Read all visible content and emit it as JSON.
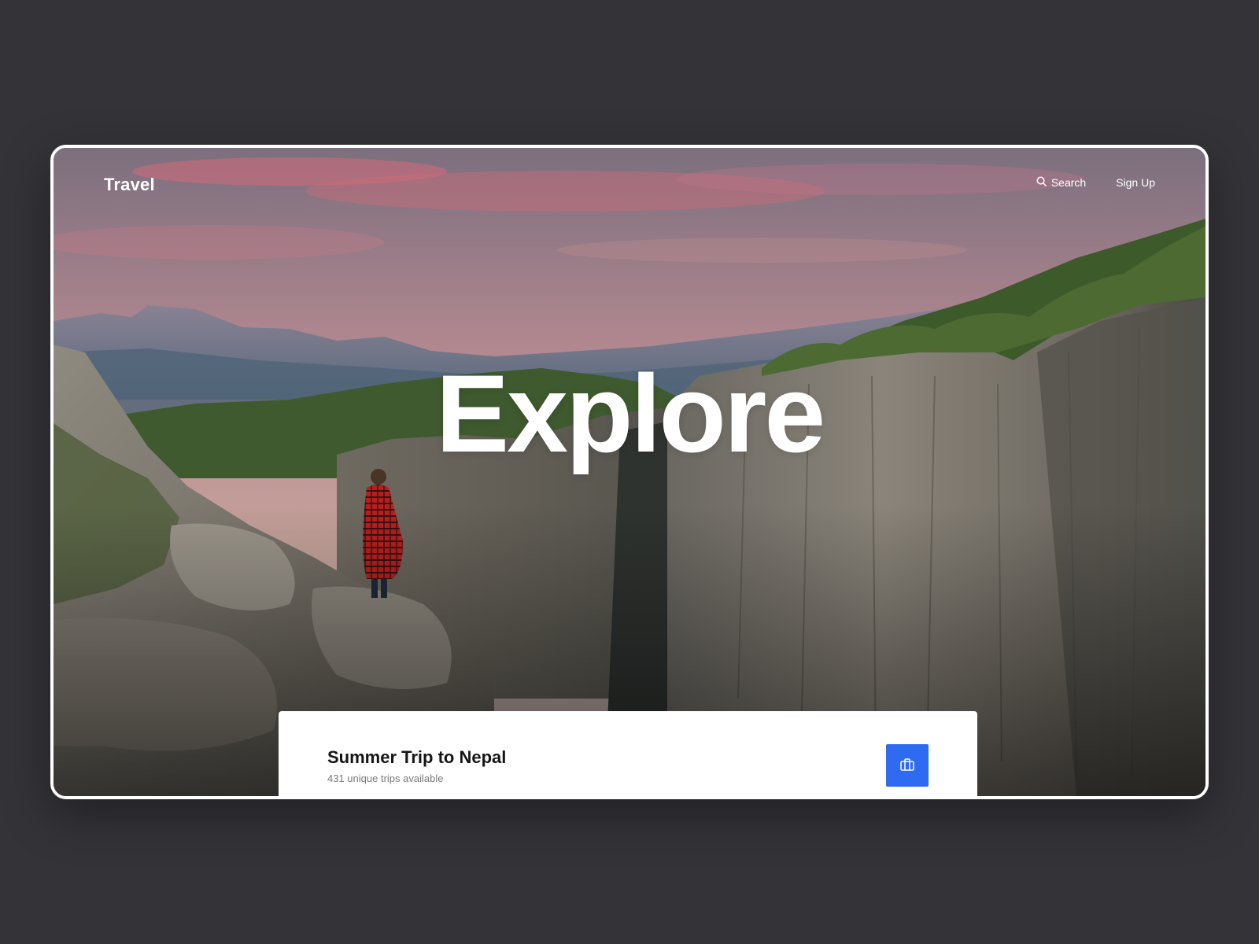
{
  "nav": {
    "logo": "Travel",
    "search_label": "Search",
    "search_icon": "search-icon",
    "signup_label": "Sign Up"
  },
  "hero": {
    "headline": "Explore",
    "image": "canyon-sunset-hiker"
  },
  "card": {
    "title": "Summer Trip to Nepal",
    "subtitle": "431 unique trips available",
    "button_icon": "briefcase-icon",
    "button_color": "#2f6bf0"
  },
  "colors": {
    "page_background": "#333338",
    "frame_border": "#ffffff",
    "accent": "#2f6bf0"
  }
}
